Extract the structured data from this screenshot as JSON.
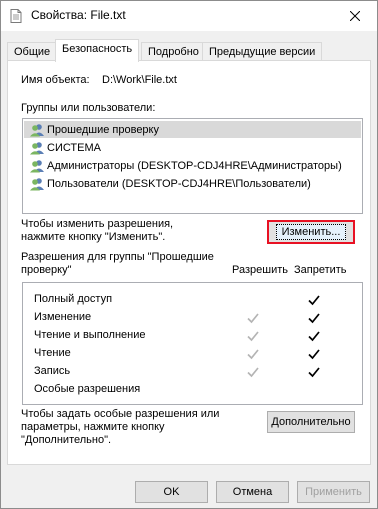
{
  "window": {
    "title": "Свойства: File.txt"
  },
  "tabs": [
    {
      "label": "Общие"
    },
    {
      "label": "Безопасность"
    },
    {
      "label": "Подробно"
    },
    {
      "label": "Предыдущие версии"
    }
  ],
  "object": {
    "label": "Имя объекта:",
    "value": "D:\\Work\\File.txt"
  },
  "groups": {
    "label": "Группы или пользователи:",
    "items": [
      {
        "label": "Прошедшие проверку"
      },
      {
        "label": "СИСТЕМА"
      },
      {
        "label": "Администраторы (DESKTOP-CDJ4HRE\\Администраторы)"
      },
      {
        "label": "Пользователи (DESKTOP-CDJ4HRE\\Пользователи)"
      }
    ]
  },
  "change": {
    "text_line1": "Чтобы изменить разрешения,",
    "text_line2": "нажмите кнопку \"Изменить\".",
    "button_label": "Изменить..."
  },
  "permissions": {
    "header_line1": "Разрешения для группы \"Прошедшие",
    "header_line2": "проверку\"",
    "allow_label": "Разрешить",
    "deny_label": "Запретить",
    "rows": [
      {
        "name": "Полный доступ",
        "allow": false,
        "deny": true
      },
      {
        "name": "Изменение",
        "allow": true,
        "deny": true
      },
      {
        "name": "Чтение и выполнение",
        "allow": true,
        "deny": true
      },
      {
        "name": "Чтение",
        "allow": true,
        "deny": true
      },
      {
        "name": "Запись",
        "allow": true,
        "deny": true
      },
      {
        "name": "Особые разрешения",
        "allow": false,
        "deny": false
      }
    ]
  },
  "advanced": {
    "text_line1": "Чтобы задать особые разрешения или",
    "text_line2": "параметры, нажмите кнопку",
    "text_line3": "\"Дополнительно\".",
    "button_label": "Дополнительно"
  },
  "footer": {
    "ok": "OK",
    "cancel": "Отмена",
    "apply": "Применить"
  },
  "colors": {
    "allow_check": "#b4b4b4",
    "deny_check": "#000000",
    "focus_border": "#e81123"
  },
  "icons": {
    "title": "file-icon",
    "close": "close-icon",
    "user": "user-group-icon",
    "check": "check-icon"
  }
}
